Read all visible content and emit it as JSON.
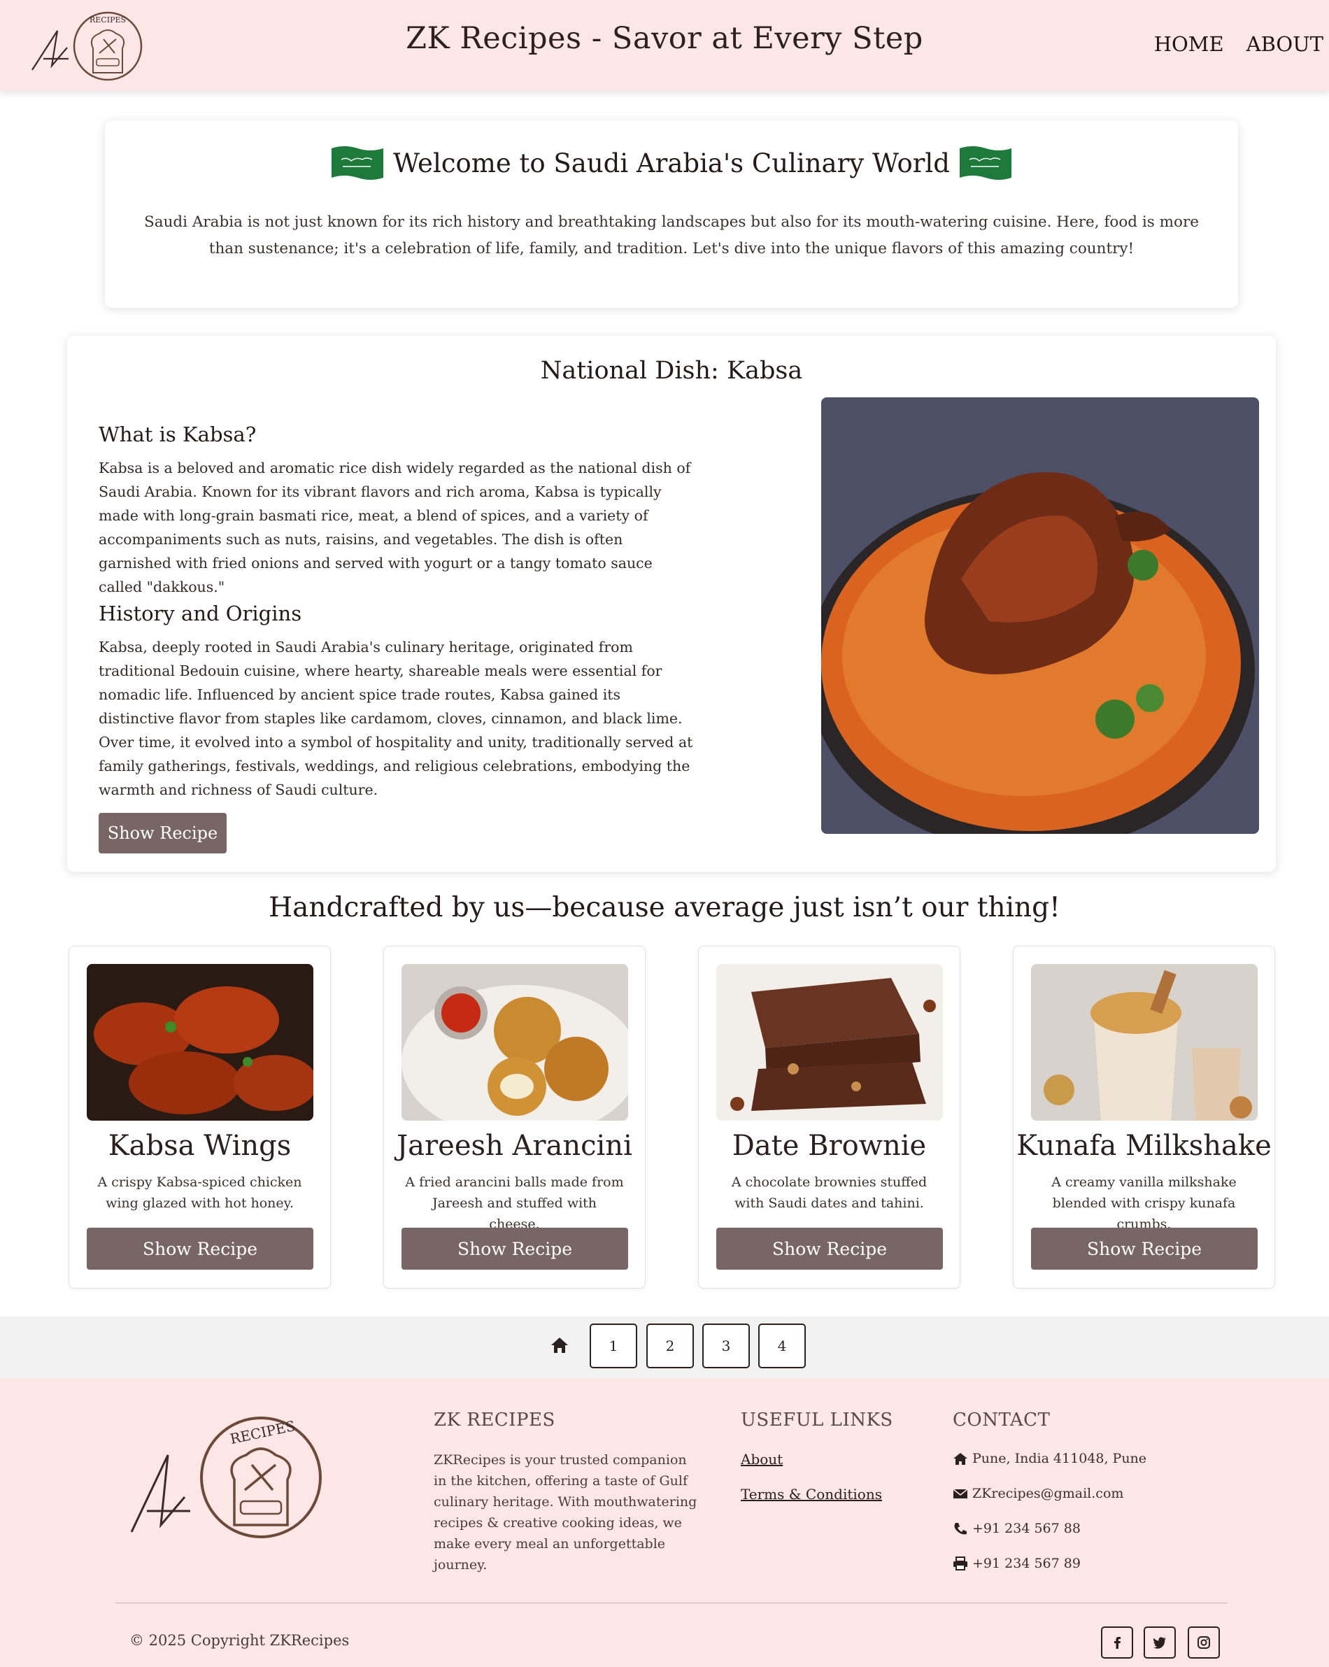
{
  "header": {
    "title": "ZK Recipes - Savor at Every Step",
    "nav": [
      "HOME",
      "ABOUT"
    ],
    "logo_text": "RECIPES"
  },
  "welcome": {
    "title": "Welcome to Saudi Arabia's Culinary World",
    "text": "Saudi Arabia is not just known for its rich history and breathtaking landscapes but also for its mouth-watering cuisine. Here, food is more than sustenance; it's a celebration of life, family, and tradition. Let's dive into the unique flavors of this amazing country!"
  },
  "national_dish": {
    "title": "National Dish: Kabsa",
    "sections": [
      {
        "heading": "What is Kabsa?",
        "text": "Kabsa is a beloved and aromatic rice dish widely regarded as the national dish of Saudi Arabia. Known for its vibrant flavors and rich aroma, Kabsa is typically made with long-grain basmati rice, meat, a blend of spices, and a variety of accompaniments such as nuts, raisins, and vegetables. The dish is often garnished with fried onions and served with yogurt or a tangy tomato sauce called \"dakkous.\""
      },
      {
        "heading": "History and Origins",
        "text": "Kabsa, deeply rooted in Saudi Arabia's culinary heritage, originated from traditional Bedouin cuisine, where hearty, shareable meals were essential for nomadic life. Influenced by ancient spice trade routes, Kabsa gained its distinctive flavor from staples like cardamom, cloves, cinnamon, and black lime. Over time, it evolved into a symbol of hospitality and unity, traditionally served at family gatherings, festivals, weddings, and religious celebrations, embodying the warmth and richness of Saudi culture."
      }
    ],
    "button": "Show Recipe"
  },
  "handcrafted": {
    "title": "Handcrafted by us—because average just isn’t our thing!",
    "cards": [
      {
        "title": "Kabsa Wings",
        "desc": "A crispy Kabsa-spiced chicken wing glazed with hot honey.",
        "button": "Show Recipe"
      },
      {
        "title": "Jareesh Arancini",
        "desc": "A fried arancini balls made from Jareesh and stuffed with cheese.",
        "button": "Show Recipe"
      },
      {
        "title": "Date Brownie",
        "desc": "A chocolate brownies stuffed with Saudi dates and tahini.",
        "button": "Show Recipe"
      },
      {
        "title": "Kunafa Milkshake",
        "desc": "A creamy vanilla milkshake blended with crispy kunafa crumbs.",
        "button": "Show Recipe"
      }
    ]
  },
  "pagination": {
    "home_icon": "home-icon",
    "pages": [
      "1",
      "2",
      "3",
      "4"
    ]
  },
  "footer": {
    "logo_text": "RECIPES",
    "about_heading": "ZK RECIPES",
    "about_text": "ZKRecipes is your trusted companion in the kitchen, offering a taste of Gulf culinary heritage. With mouthwatering recipes & creative cooking ideas, we make every meal an unforgettable journey.",
    "links_heading": "USEFUL LINKS",
    "links": [
      "About",
      "Terms & Conditions"
    ],
    "contact_heading": "CONTACT",
    "contact": [
      {
        "icon": "home-icon",
        "text": "Pune, India 411048, Pune"
      },
      {
        "icon": "envelope-icon",
        "text": "ZKrecipes@gmail.com"
      },
      {
        "icon": "phone-icon",
        "text": "+91 234 567 88"
      },
      {
        "icon": "print-icon",
        "text": "+91 234 567 89"
      }
    ],
    "copyright": "© 2025 Copyright ZKRecipes",
    "social": [
      "facebook-icon",
      "twitter-icon",
      "instagram-icon"
    ]
  },
  "colors": {
    "header_bg": "#fde6e6",
    "button_bg": "#786565",
    "pager_bg": "#f3f2f2",
    "flag_green": "#1d7a3a"
  }
}
